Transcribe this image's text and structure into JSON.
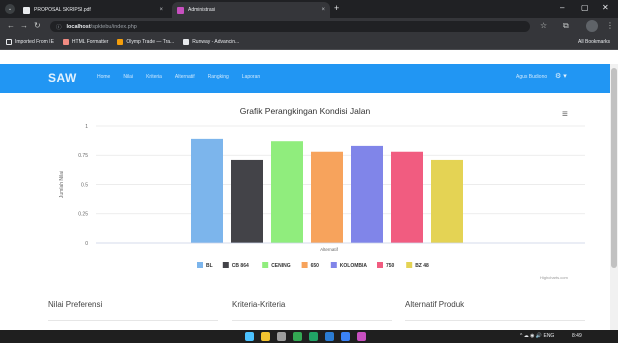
{
  "browser": {
    "tabs": [
      {
        "title": "PROPOSAL SKRIPSI.pdf",
        "close": "×",
        "icon_color": "#e8eaed"
      },
      {
        "title": "Administrasi",
        "close": "×",
        "icon_color": "#c850c0"
      }
    ],
    "new_tab": "+",
    "tab_search": "⌄",
    "window_controls": {
      "minimize": "–",
      "maximize": "▢",
      "close": "✕"
    },
    "nav": {
      "back": "←",
      "forward": "→",
      "reload": "↻",
      "site_info": "ⓘ"
    },
    "address": {
      "host": "localhost",
      "path": "/spktebu/index.php"
    },
    "toolbar_right": {
      "star": "☆",
      "extensions": "⧉",
      "menu": "⋮"
    },
    "bookmarks": [
      {
        "label": "Imported From IE",
        "color": "#e8eaed"
      },
      {
        "label": "HTML Formatter",
        "color": "#f28b82"
      },
      {
        "label": "Olymp Trade — Tra...",
        "color": "#f59e0b"
      },
      {
        "label": "Runway - Advancin...",
        "color": "#e8eaed"
      }
    ],
    "all_bookmarks": "All Bookmarks"
  },
  "app": {
    "brand": "SAW",
    "nav": [
      "Home",
      "Nilai",
      "Kriteria",
      "Alternatif",
      "Rangking",
      "Laporan"
    ],
    "user": "Agus Budiono",
    "gear": "⚙ ▾"
  },
  "chart": {
    "title": "Grafik Perangkingan Kondisi Jalan",
    "menu_icon": "≡",
    "credits": "Highcharts.com"
  },
  "chart_data": {
    "type": "bar",
    "title": "Grafik Perangkingan Kondisi Jalan",
    "xlabel": "Alternatif",
    "ylabel": "Jumlah Nilai",
    "ylim": [
      0,
      1
    ],
    "yticks": [
      "0",
      "0.25",
      "0.5",
      "0.75",
      "1"
    ],
    "grid": true,
    "legend_position": "bottom",
    "series": [
      {
        "name": "BL",
        "value": 0.89,
        "color": "#7cb5ec"
      },
      {
        "name": "CB 864",
        "value": 0.71,
        "color": "#434348"
      },
      {
        "name": "CENING",
        "value": 0.87,
        "color": "#90ed7d"
      },
      {
        "name": "650",
        "value": 0.78,
        "color": "#f7a35c"
      },
      {
        "name": "KOLOMBIA",
        "value": 0.83,
        "color": "#8085e9"
      },
      {
        "name": "750",
        "value": 0.78,
        "color": "#f15c80"
      },
      {
        "name": "BZ 48",
        "value": 0.71,
        "color": "#e4d354"
      }
    ]
  },
  "sections": [
    "Nilai Preferensi",
    "Kriteria-Kriteria",
    "Alternatif Produk"
  ],
  "taskbar": {
    "icons": [
      {
        "name": "start",
        "color": "#4cc2ff"
      },
      {
        "name": "file-explorer",
        "color": "#f4c430"
      },
      {
        "name": "notepad",
        "color": "#9e9e9e"
      },
      {
        "name": "chrome",
        "color": "#34a853"
      },
      {
        "name": "excel",
        "color": "#21a366"
      },
      {
        "name": "word",
        "color": "#2b7cd3"
      },
      {
        "name": "app-blue",
        "color": "#3b82f6"
      },
      {
        "name": "app-pink",
        "color": "#c850c0"
      }
    ],
    "tray": "^  ☁  ◉ 🔊 ENG",
    "time": "8:49"
  }
}
